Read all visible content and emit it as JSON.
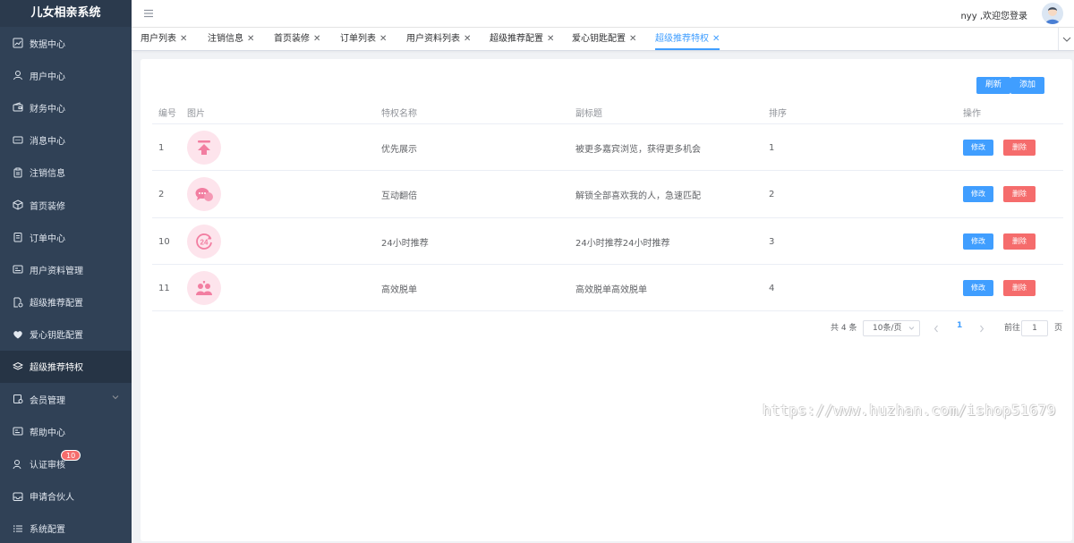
{
  "app": {
    "title": "儿女相亲系统"
  },
  "sidebar": {
    "items": [
      {
        "label": "数据中心",
        "icon": "chart-icon"
      },
      {
        "label": "用户中心",
        "icon": "user-icon"
      },
      {
        "label": "财务中心",
        "icon": "wallet-icon"
      },
      {
        "label": "消息中心",
        "icon": "message-icon"
      },
      {
        "label": "注销信息",
        "icon": "clipboard-icon"
      },
      {
        "label": "首页装修",
        "icon": "cube-icon"
      },
      {
        "label": "订单中心",
        "icon": "order-icon"
      },
      {
        "label": "用户资料管理",
        "icon": "profile-card-icon"
      },
      {
        "label": "超级推荐配置",
        "icon": "doc-gear-icon"
      },
      {
        "label": "爱心钥匙配置",
        "icon": "heart-icon"
      },
      {
        "label": "超级推荐特权",
        "icon": "layers-icon",
        "active": true
      },
      {
        "label": "会员管理",
        "icon": "member-icon",
        "expandable": true
      },
      {
        "label": "帮助中心",
        "icon": "help-card-icon"
      },
      {
        "label": "认证审核",
        "icon": "verify-user-icon",
        "badge": "10"
      },
      {
        "label": "申请合伙人",
        "icon": "inbox-icon"
      },
      {
        "label": "系统配置",
        "icon": "list-icon"
      }
    ]
  },
  "header": {
    "welcome": "nyy ,欢迎您登录"
  },
  "tabs": [
    {
      "label": "用户列表"
    },
    {
      "label": "注销信息"
    },
    {
      "label": "首页装修"
    },
    {
      "label": "订单列表"
    },
    {
      "label": "用户资料列表"
    },
    {
      "label": "超级推荐配置"
    },
    {
      "label": "爱心钥匙配置"
    },
    {
      "label": "超级推荐特权",
      "active": true
    }
  ],
  "toolbar": {
    "refresh_label": "刷新",
    "add_label": "添加"
  },
  "table": {
    "headers": {
      "id": "编号",
      "image": "图片",
      "name": "特权名称",
      "subtitle": "副标题",
      "sort": "排序",
      "actions": "操作"
    },
    "rows": [
      {
        "id": "1",
        "icon": "top-arrow-icon",
        "name": "优先展示",
        "subtitle": "被更多嘉宾浏览，获得更多机会",
        "sort": "1",
        "edit": "修改",
        "delete": "删除"
      },
      {
        "id": "2",
        "icon": "chat-bubble-icon",
        "name": "互动翻倍",
        "subtitle": "解锁全部喜欢我的人，急速匹配",
        "sort": "2",
        "edit": "修改",
        "delete": "删除"
      },
      {
        "id": "10",
        "icon": "clock-24-icon",
        "name": "24小时推荐",
        "subtitle": "24小时推荐24小时推荐",
        "sort": "3",
        "edit": "修改",
        "delete": "删除"
      },
      {
        "id": "11",
        "icon": "couple-icon",
        "name": "高效脱单",
        "subtitle": "高效脱单高效脱单",
        "sort": "4",
        "edit": "修改",
        "delete": "删除"
      }
    ]
  },
  "pagination": {
    "total": "共 4 条",
    "page_size": "10条/页",
    "current_page": "1",
    "goto_label": "前往",
    "goto_value": "1",
    "page_unit": "页"
  },
  "watermark": "https://www.huzhan.com/ishop51679",
  "colors": {
    "sidebar": "#304156",
    "primary": "#409eff",
    "danger": "#f56c6c",
    "icon_bg": "#fde4ec",
    "icon_fg": "#f27ea1"
  }
}
